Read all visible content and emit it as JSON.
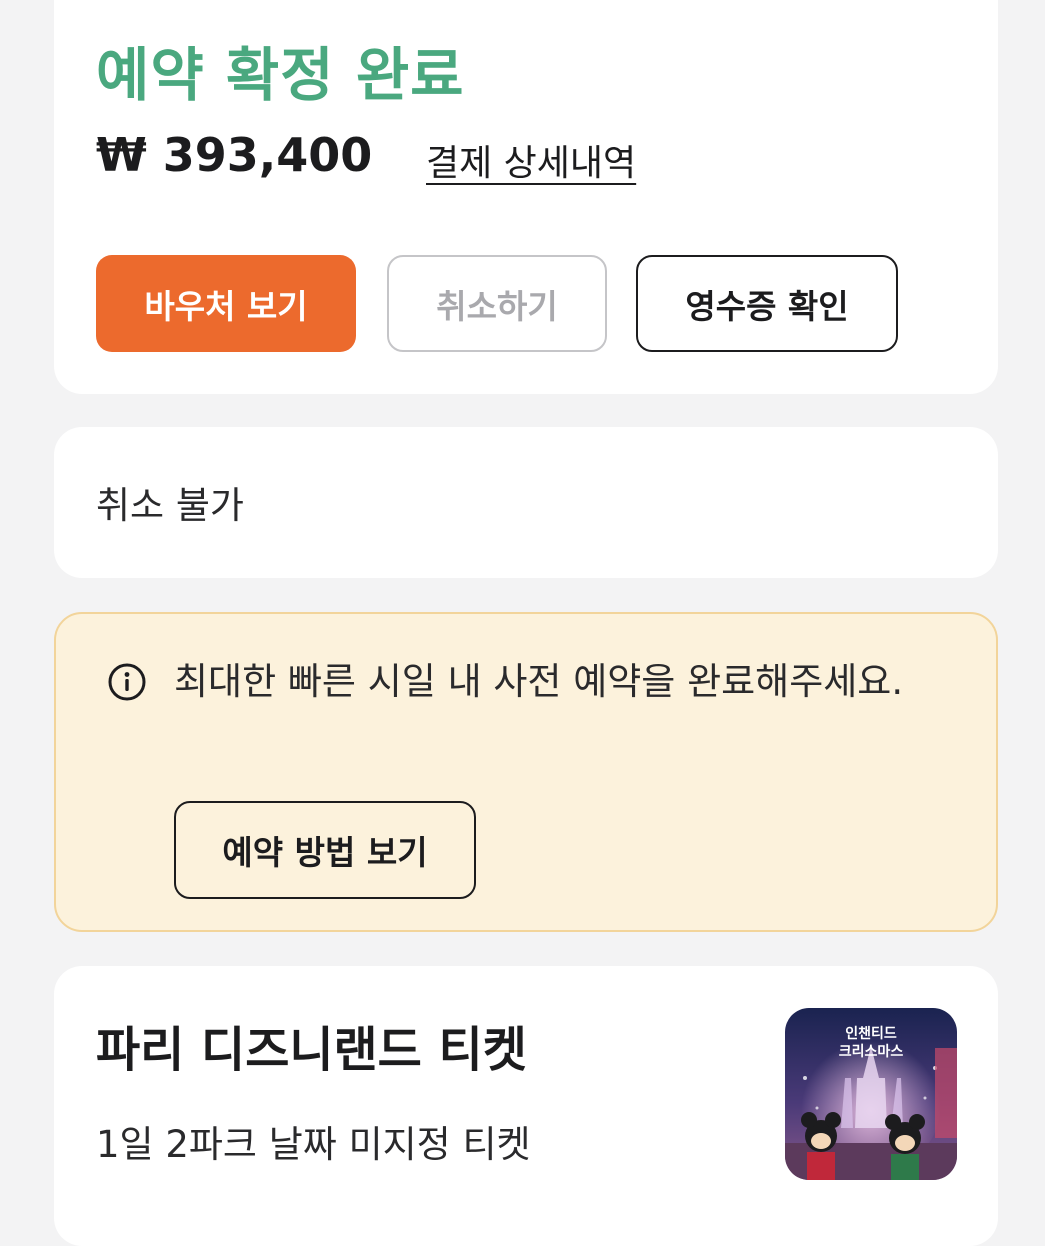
{
  "booking": {
    "status_title": "예약 확정 완료",
    "price": "₩ 393,400",
    "payment_detail_link": "결제 상세내역",
    "buttons": {
      "voucher": "바우처 보기",
      "cancel": "취소하기",
      "receipt": "영수증 확인"
    }
  },
  "cancellation": {
    "policy_text": "취소 불가"
  },
  "notice": {
    "icon": "info-icon",
    "message": "최대한 빠른 시일 내 사전 예약을 완료해주세요.",
    "button": "예약 방법 보기"
  },
  "product": {
    "title": "파리 디즈니랜드 티켓",
    "subtitle": "1일 2파크 날짜 미지정 티켓",
    "thumbnail_caption": "인챈티드\n크리스마스"
  },
  "colors": {
    "status_green": "#4aa87f",
    "voucher_orange": "#ec6a2d",
    "notice_bg": "#fcf2dc",
    "notice_border": "#f2d49a"
  }
}
